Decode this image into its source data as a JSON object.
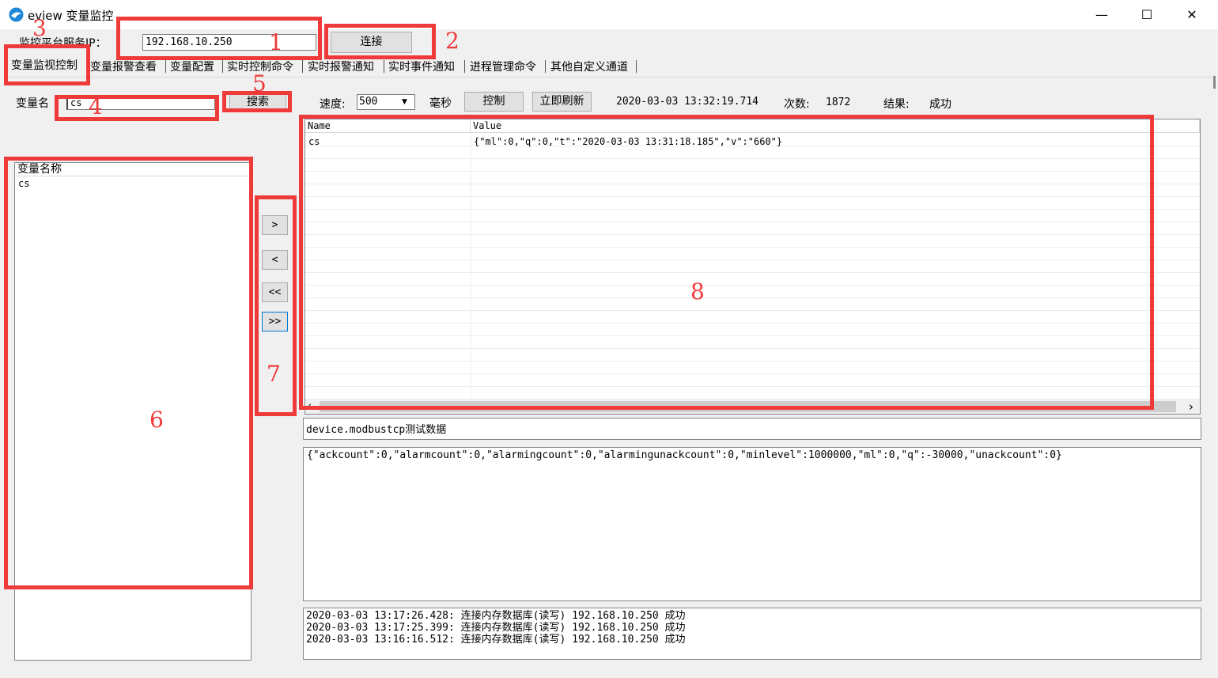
{
  "window": {
    "title": "eview 变量监控",
    "minimize": "—",
    "maximize": "☐",
    "close": "✕"
  },
  "connection": {
    "ip_label": "监控平台服务IP：",
    "ip_value": "192.168.10.250",
    "connect_label": "连接"
  },
  "tabs": [
    "变量监视控制",
    "变量报警查看",
    "变量配置",
    "实时控制命令",
    "实时报警通知",
    "实时事件通知",
    "进程管理命令",
    "其他自定义通道"
  ],
  "search": {
    "label": "变量名",
    "value": "cs",
    "button": "搜索"
  },
  "controls": {
    "speed_label": "速度:",
    "speed_value": "500",
    "ms_label": "毫秒",
    "control_button": "控制",
    "refresh_button": "立即刷新",
    "timestamp": "2020-03-03 13:32:19.714",
    "count_label": "次数:",
    "count_value": "1872",
    "result_label": "结果:",
    "result_value": "成功"
  },
  "var_list": {
    "header": "变量名称",
    "items": [
      "cs"
    ]
  },
  "transfer_buttons": [
    ">",
    "<",
    "<<",
    ">>"
  ],
  "grid": {
    "headers": [
      "Name",
      "Value"
    ],
    "rows": [
      {
        "name": "cs",
        "value": "{\"ml\":0,\"q\":0,\"t\":\"2020-03-03 13:31:18.185\",\"v\":\"660\"}"
      }
    ]
  },
  "description": "device.modbustcp测试数据",
  "alarm_json": "{\"ackcount\":0,\"alarmcount\":0,\"alarmingcount\":0,\"alarmingunackcount\":0,\"minlevel\":1000000,\"ml\":0,\"q\":-30000,\"unackcount\":0}",
  "log": [
    "2020-03-03 13:17:26.428: 连接内存数据库(读写) 192.168.10.250 成功",
    "2020-03-03 13:17:25.399: 连接内存数据库(读写) 192.168.10.250 成功",
    "2020-03-03 13:16:16.512: 连接内存数据库(读写) 192.168.10.250 成功"
  ],
  "annotations": [
    "1",
    "2",
    "3",
    "4",
    "5",
    "6",
    "7",
    "8"
  ],
  "colors": {
    "annotation_red": "#ef3a3a",
    "window_bg": "#f0f0f0",
    "app_icon_blue": "#1e88d6"
  }
}
